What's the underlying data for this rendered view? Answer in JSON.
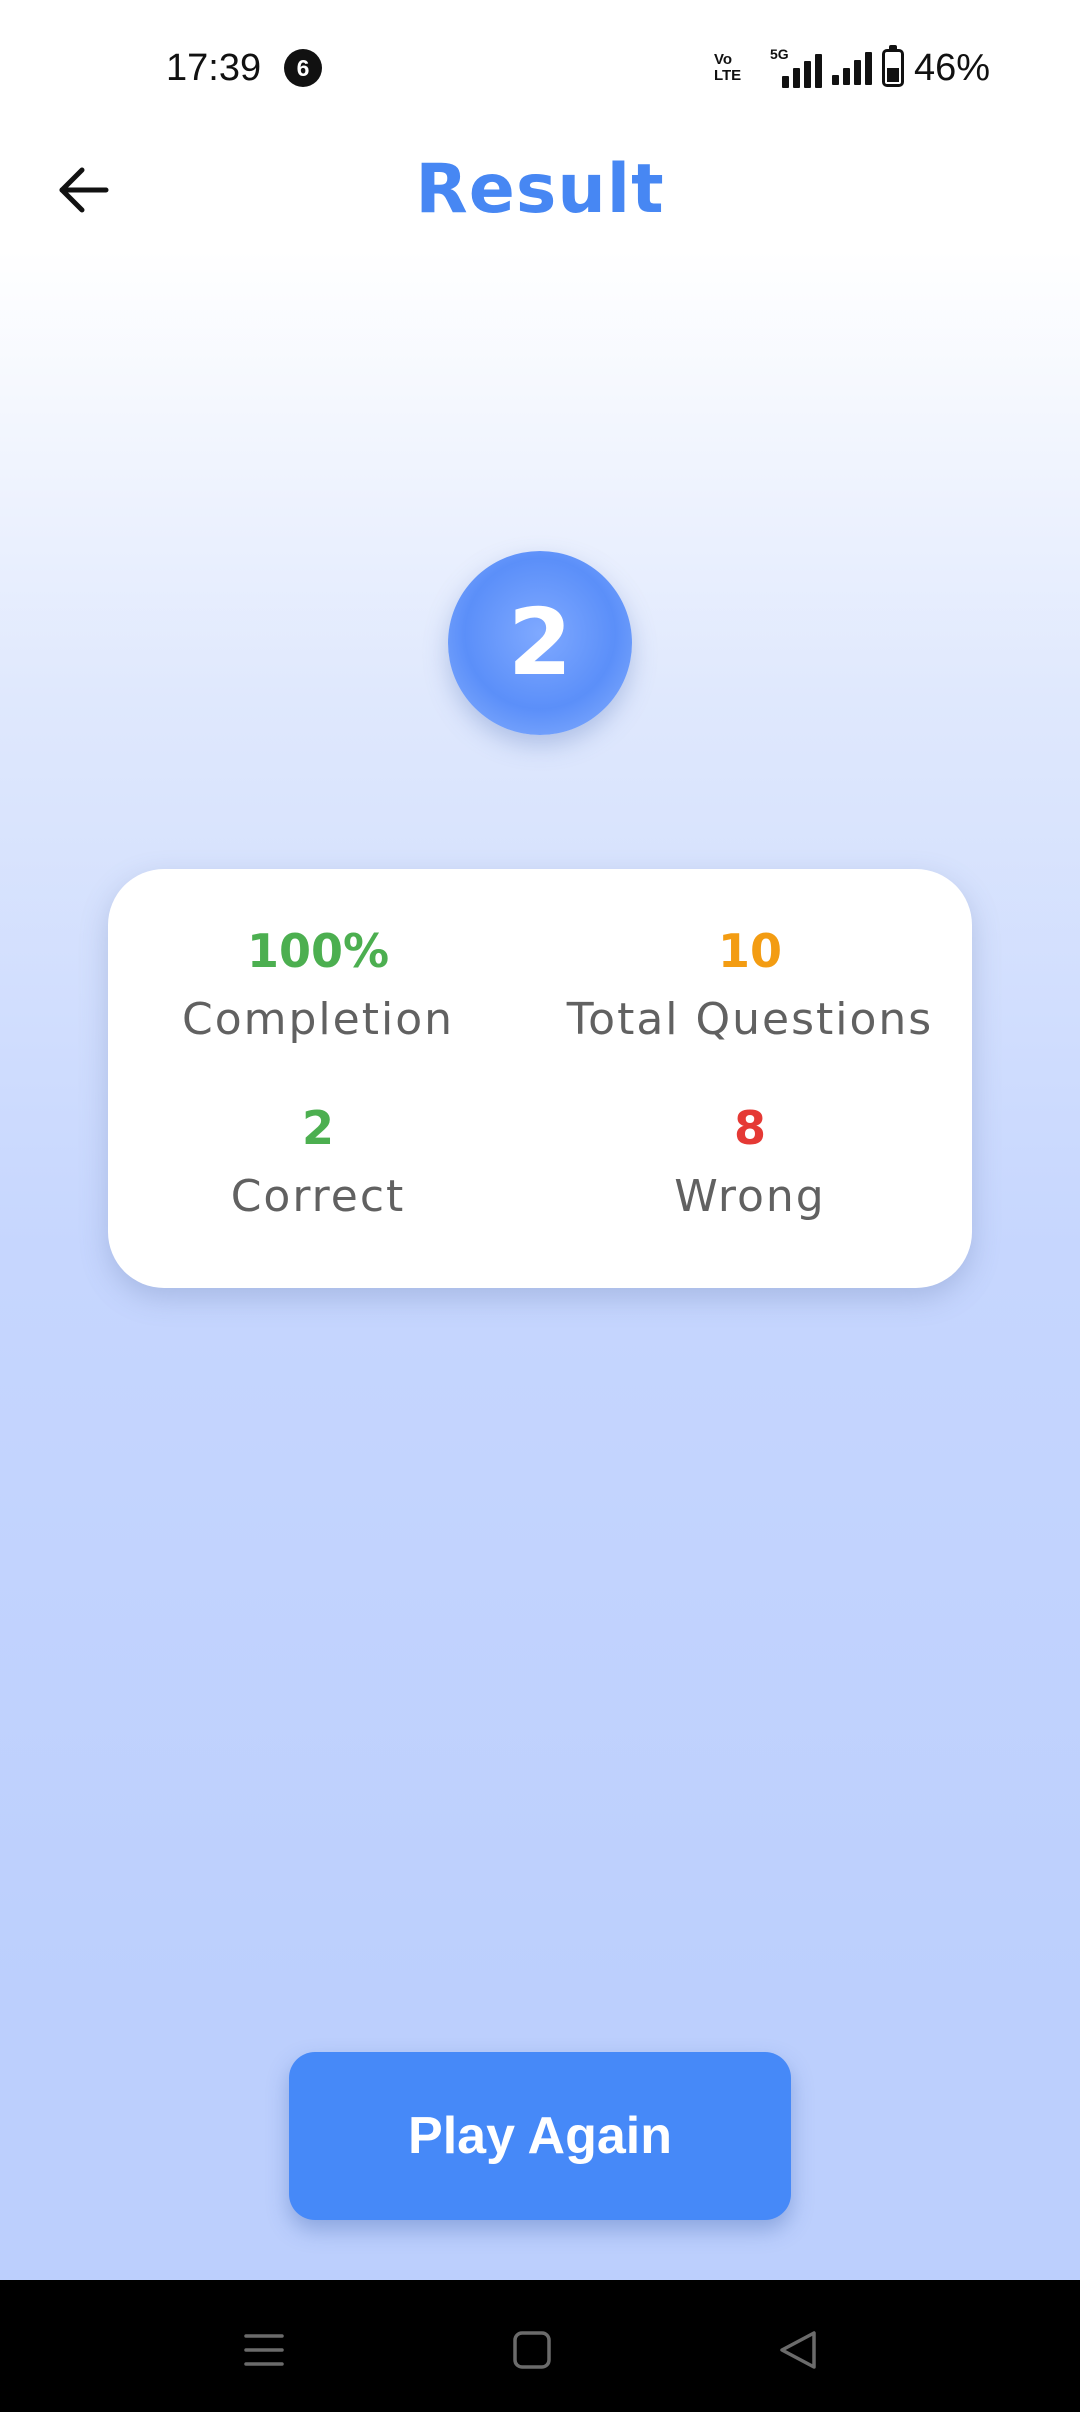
{
  "status_bar": {
    "time": "17:39",
    "notification_count": "6",
    "volte_label_line1": "Vo",
    "volte_label_line2": "LTE",
    "network_tag": "5G",
    "battery_percent": "46%"
  },
  "header": {
    "title": "Result",
    "back_icon": "arrow-left-icon"
  },
  "score": {
    "value": "2"
  },
  "stats": {
    "completion": {
      "value": "100%",
      "label": "Completion",
      "color": "#4caf50"
    },
    "total_questions": {
      "value": "10",
      "label": "Total Questions",
      "color": "#f39c12"
    },
    "correct": {
      "value": "2",
      "label": "Correct",
      "color": "#4caf50"
    },
    "wrong": {
      "value": "8",
      "label": "Wrong",
      "color": "#e53935"
    }
  },
  "actions": {
    "play_again_label": "Play Again"
  },
  "colors": {
    "accent": "#4787f3",
    "button": "#4689f8",
    "background_top": "#ffffff",
    "background_bottom": "#bccffd"
  },
  "nav_bar": {
    "recents_icon": "menu-icon",
    "home_icon": "square-home-icon",
    "back_icon": "triangle-back-icon"
  }
}
